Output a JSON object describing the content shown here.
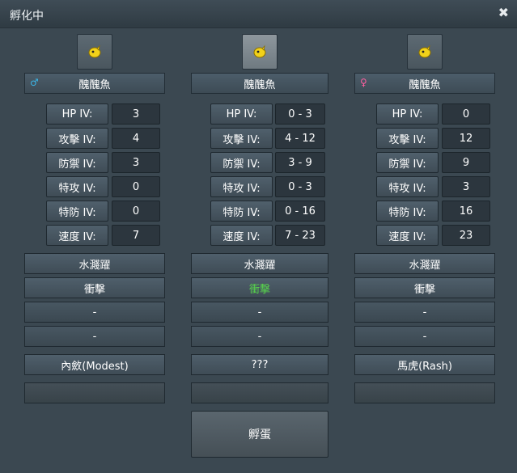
{
  "window": {
    "title": "孵化中",
    "close_icon": "close-icon"
  },
  "parents": [
    {
      "name": "醜醜魚",
      "gender": "male",
      "gender_symbol": "♂",
      "stats": [
        {
          "label": "HP IV:",
          "value": "3"
        },
        {
          "label": "攻擊 IV:",
          "value": "4"
        },
        {
          "label": "防禦 IV:",
          "value": "3"
        },
        {
          "label": "特攻 IV:",
          "value": "0"
        },
        {
          "label": "特防 IV:",
          "value": "0"
        },
        {
          "label": "速度 IV:",
          "value": "7"
        }
      ],
      "moves": [
        "水濺躍",
        "衝擊",
        "-",
        "-"
      ],
      "nature": "內斂(Modest)",
      "extra": ""
    },
    {
      "name": "醜醜魚",
      "gender": "none",
      "gender_symbol": "",
      "stats": [
        {
          "label": "HP IV:",
          "value": "0 - 3"
        },
        {
          "label": "攻擊 IV:",
          "value": "4 - 12"
        },
        {
          "label": "防禦 IV:",
          "value": "3 - 9"
        },
        {
          "label": "特攻 IV:",
          "value": "0 - 3"
        },
        {
          "label": "特防 IV:",
          "value": "0 - 16"
        },
        {
          "label": "速度 IV:",
          "value": "7 - 23"
        }
      ],
      "moves": [
        "水濺躍",
        "衝擊",
        "-",
        "-"
      ],
      "nature": "???",
      "extra": ""
    },
    {
      "name": "醜醜魚",
      "gender": "female",
      "gender_symbol": "♀",
      "stats": [
        {
          "label": "HP IV:",
          "value": "0"
        },
        {
          "label": "攻擊 IV:",
          "value": "12"
        },
        {
          "label": "防禦 IV:",
          "value": "9"
        },
        {
          "label": "特攻 IV:",
          "value": "3"
        },
        {
          "label": "特防 IV:",
          "value": "16"
        },
        {
          "label": "速度 IV:",
          "value": "23"
        }
      ],
      "moves": [
        "水濺躍",
        "衝擊",
        "-",
        "-"
      ],
      "nature": "馬虎(Rash)",
      "extra": ""
    }
  ],
  "hatch_button": "孵蛋",
  "colors": {
    "highlight_move": "#57d64b",
    "male": "#3bb6e8",
    "female": "#ff5fa0"
  }
}
